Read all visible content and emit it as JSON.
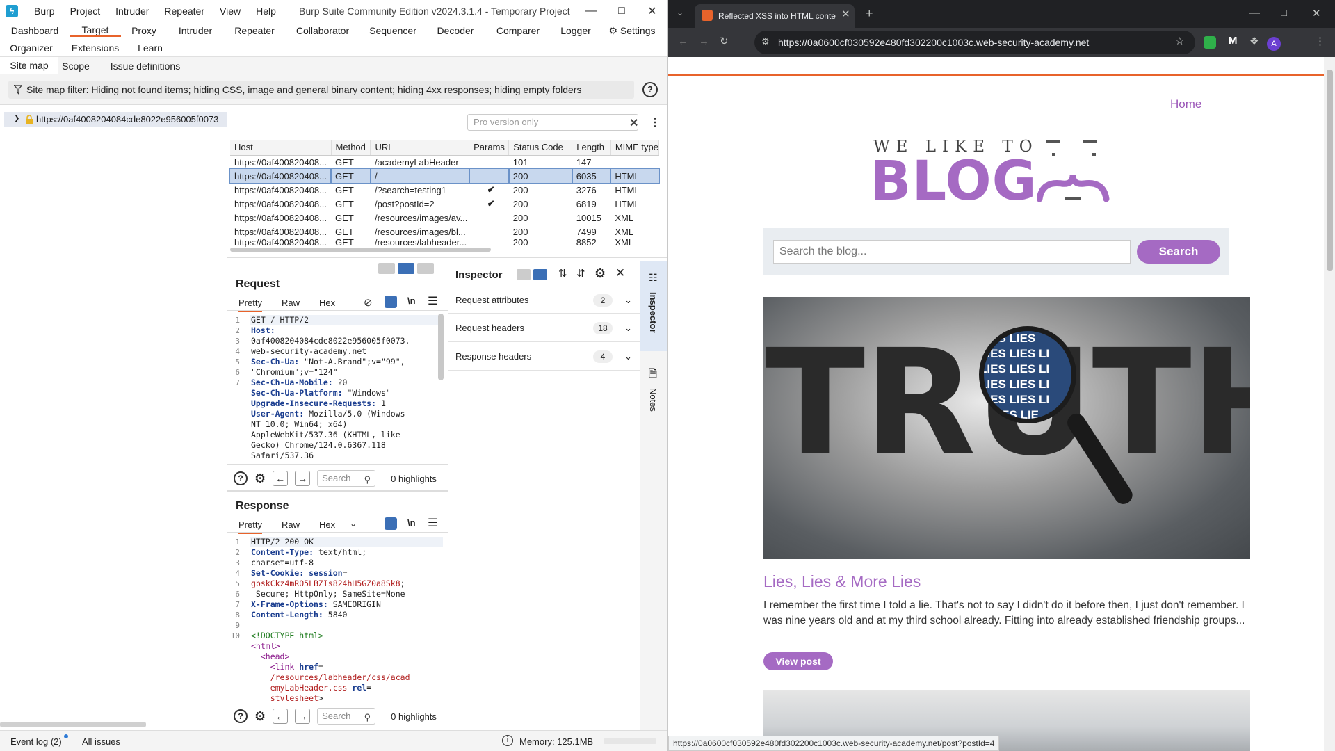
{
  "burp": {
    "window_title": "Burp Suite Community Edition v2024.3.1.4 - Temporary Project",
    "menu": [
      "Burp",
      "Project",
      "Intruder",
      "Repeater",
      "View",
      "Help"
    ],
    "tabs_row1": [
      "Dashboard",
      "Target",
      "Proxy",
      "Intruder",
      "Repeater",
      "Collaborator",
      "Sequencer",
      "Decoder",
      "Comparer",
      "Logger",
      "Settings"
    ],
    "tabs_row2": [
      "Organizer",
      "Extensions",
      "Learn"
    ],
    "subtabs": [
      "Site map",
      "Scope",
      "Issue definitions"
    ],
    "active_tab": "Target",
    "active_subtab": "Site map",
    "filter_text": "Site map filter: Hiding not found items; hiding CSS, image and general binary content; hiding 4xx responses; hiding empty folders",
    "tree_host": "https://0af4008204084cde8022e956005f0073",
    "pro_version_placeholder": "Pro version only",
    "sitemap_columns": [
      "Host",
      "Method",
      "URL",
      "Params",
      "Status Code",
      "Length",
      "MIME type"
    ],
    "sitemap_rows": [
      {
        "host": "https://0af400820408...",
        "method": "GET",
        "url": "/academyLabHeader",
        "params": "",
        "status": "101",
        "length": "147",
        "mime": ""
      },
      {
        "host": "https://0af400820408...",
        "method": "GET",
        "url": "/",
        "params": "",
        "status": "200",
        "length": "6035",
        "mime": "HTML"
      },
      {
        "host": "https://0af400820408...",
        "method": "GET",
        "url": "/?search=testing1",
        "params": "✔",
        "status": "200",
        "length": "3276",
        "mime": "HTML"
      },
      {
        "host": "https://0af400820408...",
        "method": "GET",
        "url": "/post?postId=2",
        "params": "✔",
        "status": "200",
        "length": "6819",
        "mime": "HTML"
      },
      {
        "host": "https://0af400820408...",
        "method": "GET",
        "url": "/resources/images/av...",
        "params": "",
        "status": "200",
        "length": "10015",
        "mime": "XML"
      },
      {
        "host": "https://0af400820408...",
        "method": "GET",
        "url": "/resources/images/bl...",
        "params": "",
        "status": "200",
        "length": "7499",
        "mime": "XML"
      },
      {
        "host": "https://0af400820408...",
        "method": "GET",
        "url": "/resources/labheader...",
        "params": "",
        "status": "200",
        "length": "8852",
        "mime": "XML"
      }
    ],
    "request": {
      "title": "Request",
      "tabs": [
        "Pretty",
        "Raw",
        "Hex"
      ],
      "search_placeholder": "Search",
      "highlights": "0 highlights"
    },
    "response": {
      "title": "Response",
      "tabs": [
        "Pretty",
        "Raw",
        "Hex"
      ],
      "search_placeholder": "Search",
      "highlights": "0 highlights"
    },
    "inspector": {
      "title": "Inspector",
      "rows": [
        {
          "label": "Request attributes",
          "count": "2"
        },
        {
          "label": "Request headers",
          "count": "18"
        },
        {
          "label": "Response headers",
          "count": "4"
        }
      ],
      "side_tabs": [
        "Inspector",
        "Notes"
      ]
    },
    "statusbar": {
      "event_log": "Event log (2)",
      "all_issues": "All issues",
      "memory": "Memory: 125.1MB"
    }
  },
  "browser": {
    "tab_title": "Reflected XSS into HTML conte",
    "url": "https://0a0600cf030592e480fd302200c1003c.web-security-academy.net",
    "avatar_letter": "A",
    "status_url": "https://0a0600cf030592e480fd302200c1003c.web-security-academy.net/post?postId=4",
    "page": {
      "home_link": "Home",
      "logo_small": "WE LIKE TO",
      "logo_big": "BLOG",
      "search_placeholder": "Search the blog...",
      "search_button": "Search",
      "hero_word": "TRUTH",
      "lens_text": [
        "LIES LIES",
        "LIES LIES LI",
        "LIES LIES LI",
        "LIES LIES LI",
        "LIES LIES LI",
        "S LIES LIE"
      ],
      "post_title": "Lies, Lies & More Lies",
      "post_excerpt": "I remember the first time I told a lie. That's not to say I didn't do it before then, I just don't remember. I was nine years old and at my third school already. Fitting into already established friendship groups...",
      "view_post": "View post"
    }
  },
  "colors": {
    "accent_orange": "#e8632b",
    "blog_purple": "#a56ac3",
    "selection_blue": "#c8d8ee"
  }
}
